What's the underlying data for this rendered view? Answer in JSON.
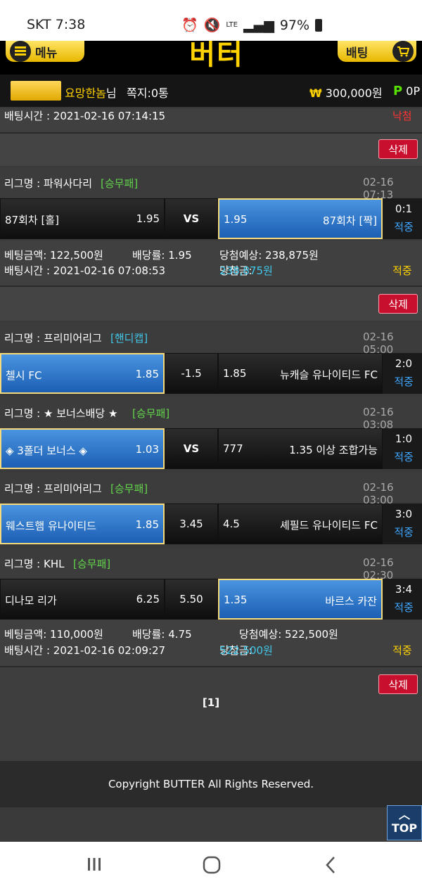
{
  "status": {
    "carrier_time": "SKT 7:38",
    "network": "LTE",
    "battery": "97%"
  },
  "header": {
    "menu_label": "메뉴",
    "logo": "버터",
    "bet_label": "배팅"
  },
  "user": {
    "name": "요망한놈",
    "suffix": "님",
    "notes": "쪽지:0통",
    "money": "300,000원",
    "won_symbol": "₩",
    "point_label": "P",
    "point": "0P"
  },
  "top_bet": {
    "time": "배팅시간 : 2021-02-16 07:14:15",
    "status": "낙첨"
  },
  "delete_label": "삭제",
  "bet1": {
    "league_label": "리그명 : 파워사다리",
    "league_type": "[승무패]",
    "date": "02-16 07:13",
    "home": "87회차 [홀]",
    "home_odds": "1.95",
    "mid": "VS",
    "away_odds": "1.95",
    "away": "87회차 [짝]",
    "score": "0:1",
    "result": "적중",
    "amount": "베팅금액: 122,500원",
    "rate": "배당률: 1.95",
    "expected": "당첨예상: 238,875원",
    "time": "배팅시간 : 2021-02-16 07:08:53",
    "win_label": "당첨금:",
    "win": "238,875원",
    "status": "적중"
  },
  "bet2": {
    "matches": [
      {
        "league_label": "리그명 : 프리미어리그",
        "league_type": "[핸디캡]",
        "date": "02-16 05:00",
        "home": "첼시 FC",
        "home_odds": "1.85",
        "mid": "-1.5",
        "away_odds": "1.85",
        "away": "뉴캐슬 유나이티드 FC",
        "score": "2:0",
        "result": "적중"
      },
      {
        "league_label": "리그명 : ★ 보너스배당 ★",
        "league_type": "[승무패]",
        "date": "02-16 03:08",
        "home": "◈ 3폴더 보너스 ◈",
        "home_odds": "1.03",
        "mid": "VS",
        "away_odds": "777",
        "away": "1.35 이상 조합가능",
        "score": "1:0",
        "result": "적중"
      },
      {
        "league_label": "리그명 : 프리미어리그",
        "league_type": "[승무패]",
        "date": "02-16 03:00",
        "home": "웨스트햄 유나이티드",
        "home_odds": "1.85",
        "mid": "3.45",
        "away_odds": "4.5",
        "away": "셰필드 유나이티드 FC",
        "score": "3:0",
        "result": "적중"
      },
      {
        "league_label": "리그명 : KHL",
        "league_type": "[승무패]",
        "date": "02-16 02:30",
        "home": "디나모 리가",
        "home_odds": "6.25",
        "mid": "5.50",
        "away_odds": "1.35",
        "away": "바르스 카잔",
        "score": "3:4",
        "result": "적중"
      }
    ],
    "amount": "베팅금액: 110,000원",
    "rate": "배당률: 4.75",
    "expected": "당첨예상: 522,500원",
    "time": "배팅시간 : 2021-02-16 02:09:27",
    "win_label": "당첨금:",
    "win": "522,500원",
    "status": "적중"
  },
  "pager": "[1]",
  "footer": "Copyright BUTTER All Rights Reserved.",
  "top_label": "TOP"
}
